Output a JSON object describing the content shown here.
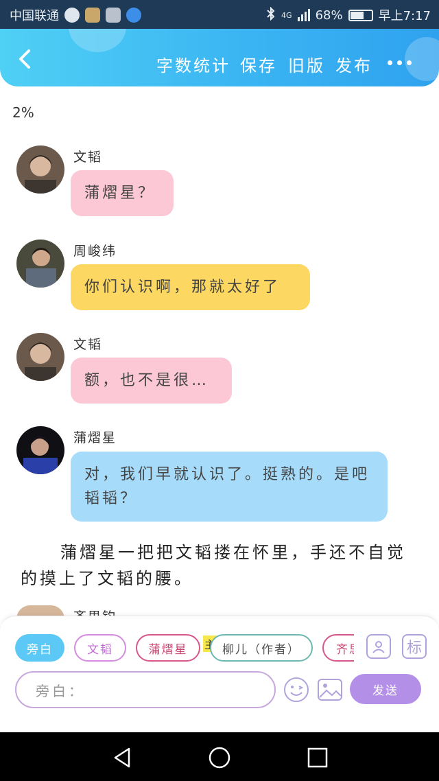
{
  "status_bar": {
    "carrier": "中国联通",
    "network": "4G",
    "battery": "68%",
    "battery_level": 0.68,
    "time": "早上7:17"
  },
  "header": {
    "actions": [
      "字数统计",
      "保存",
      "旧版",
      "发布"
    ]
  },
  "progress_text": "2%",
  "messages": [
    {
      "author": "文韬",
      "text": "蒲熠星？",
      "color": "#fcc8d6"
    },
    {
      "author": "周峻纬",
      "text": "你们认识啊，那就太好了",
      "color": "#fcd862"
    },
    {
      "author": "文韬",
      "text": "额，也不是很…",
      "color": "#fcc8d6"
    },
    {
      "author": "蒲熠星",
      "text": "对，我们早就认识了。挺熟的。是吧韬韬？",
      "color": "#a6dbfa"
    }
  ],
  "narration": "蒲熠星一把把文韬搂在怀里，手还不自觉的摸上了文韬的腰。",
  "next_author_partial": "齐思钧",
  "input_panel": {
    "chips": [
      "旁白",
      "文韬",
      "蒲熠星",
      "柳儿（作者）",
      "齐思钧"
    ],
    "host_tag": "主",
    "tag_button_label": "标",
    "placeholder": "旁白：",
    "send_label": "发送"
  },
  "colors": {
    "header_start": "#4fd0f5",
    "header_end": "#2fa2ef",
    "send_button": "#b38fe8",
    "narration_chip": "#5bc8f5"
  }
}
